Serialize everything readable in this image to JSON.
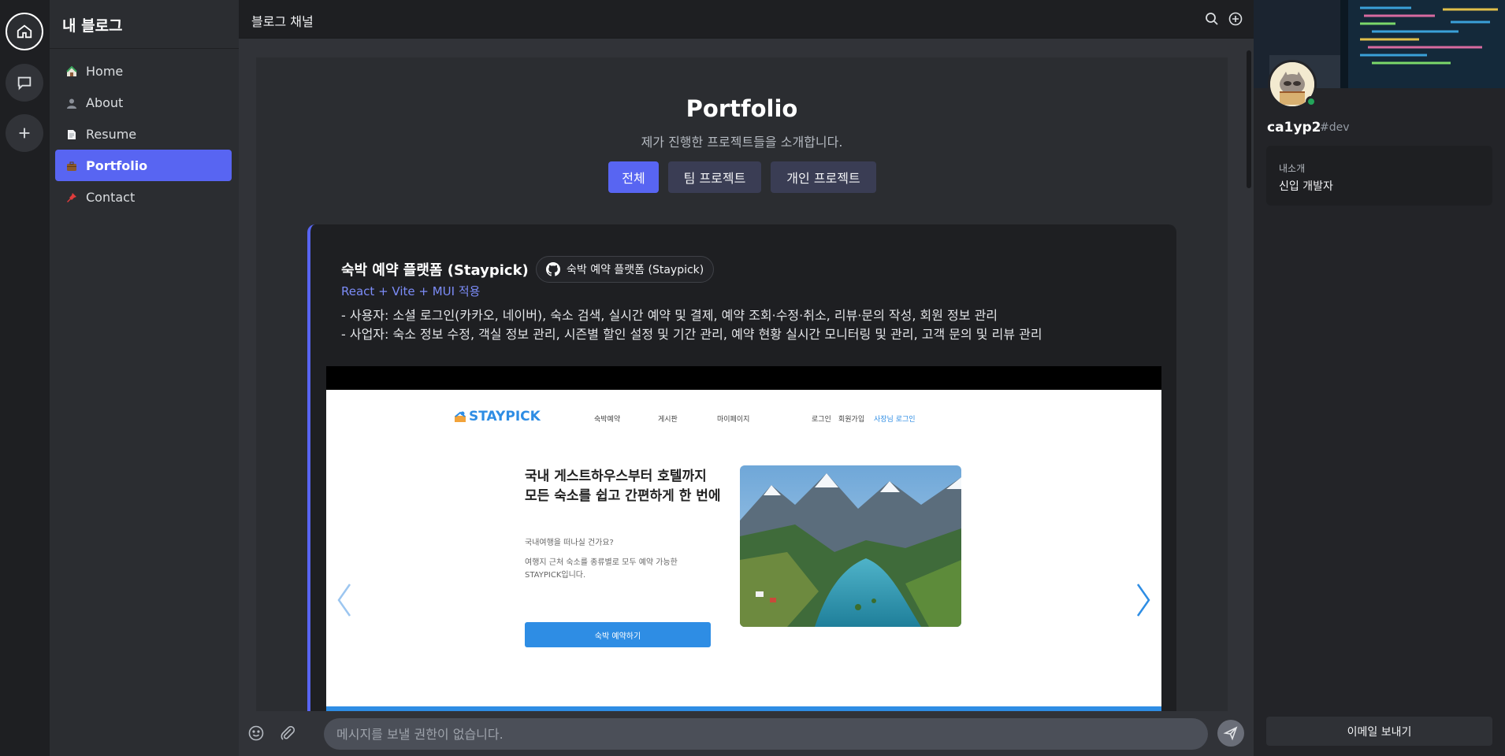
{
  "rail": {
    "items": [
      {
        "name": "home-icon"
      },
      {
        "name": "chat-icon"
      },
      {
        "name": "plus-icon"
      }
    ]
  },
  "sidebar": {
    "title": "내 블로그",
    "items": [
      {
        "label": "Home",
        "icon": "house-icon",
        "active": false
      },
      {
        "label": "About",
        "icon": "person-icon",
        "active": false
      },
      {
        "label": "Resume",
        "icon": "document-icon",
        "active": false
      },
      {
        "label": "Portfolio",
        "icon": "briefcase-icon",
        "active": true
      },
      {
        "label": "Contact",
        "icon": "pushpin-icon",
        "active": false
      }
    ]
  },
  "header": {
    "channel": "블로그 채널",
    "icons": [
      "search-icon",
      "add-circle-icon"
    ]
  },
  "main": {
    "title": "Portfolio",
    "subtitle": "제가 진행한 프로젝트들을 소개합니다.",
    "filters": [
      {
        "label": "전체",
        "active": true
      },
      {
        "label": "팀 프로젝트",
        "active": false
      },
      {
        "label": "개인 프로젝트",
        "active": false
      }
    ],
    "project": {
      "title": "숙박 예약 플랫폼 (Staypick)",
      "repo_label": "숙박 예약 플랫폼 (Staypick)",
      "stack": "React + Vite + MUI 적용",
      "desc_user": "- 사용자: 소셜 로그인(카카오, 네이버), 숙소 검색, 실시간 예약 및 결제, 예약 조회·수정·취소, 리뷰·문의 작성, 회원 정보 관리",
      "desc_biz": "- 사업자: 숙소 정보 수정, 객실 정보 관리, 시즌별 할인 설정 및 기간 관리, 예약 현황 실시간 모니터링 및 관리, 고객 문의 및 리뷰 관리",
      "screenshot": {
        "logo": "STAYPICK",
        "nav": [
          "숙박예약",
          "게시판",
          "마이페이지"
        ],
        "auth": [
          "로그인",
          "회원가입",
          "사장님 로그인"
        ],
        "headline_1": "국내 게스트하우스부터 호텔까지",
        "headline_2": "모든 숙소를 쉽고 간편하게 한 번에",
        "question": "국내여행을 떠나실 건가요?",
        "desc_1": "여행지 근처 숙소를 종류별로 모두 예약 가능한",
        "desc_2": "STAYPICK입니다.",
        "cta": "숙박 예약하기"
      }
    }
  },
  "composer": {
    "placeholder": "메시지를 보낼 권한이 없습니다."
  },
  "profile": {
    "username": "ca1yp2",
    "tag": "#dev",
    "about_heading": "내소개",
    "about_text": "신입 개발자",
    "email_button": "이메일 보내기",
    "status_color": "#23a55a"
  },
  "colors": {
    "accent": "#5865f2",
    "staypick_blue": "#2e8de4"
  }
}
